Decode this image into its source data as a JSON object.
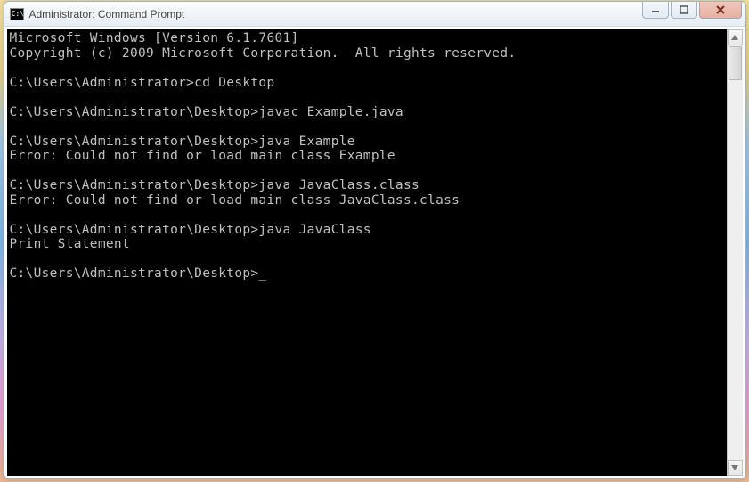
{
  "window": {
    "title": "Administrator: Command Prompt",
    "icon_glyph": "C:\\"
  },
  "console": {
    "lines": [
      "Microsoft Windows [Version 6.1.7601]",
      "Copyright (c) 2009 Microsoft Corporation.  All rights reserved.",
      "",
      "C:\\Users\\Administrator>cd Desktop",
      "",
      "C:\\Users\\Administrator\\Desktop>javac Example.java",
      "",
      "C:\\Users\\Administrator\\Desktop>java Example",
      "Error: Could not find or load main class Example",
      "",
      "C:\\Users\\Administrator\\Desktop>java JavaClass.class",
      "Error: Could not find or load main class JavaClass.class",
      "",
      "C:\\Users\\Administrator\\Desktop>java JavaClass",
      "Print Statement",
      "",
      "C:\\Users\\Administrator\\Desktop>"
    ]
  }
}
